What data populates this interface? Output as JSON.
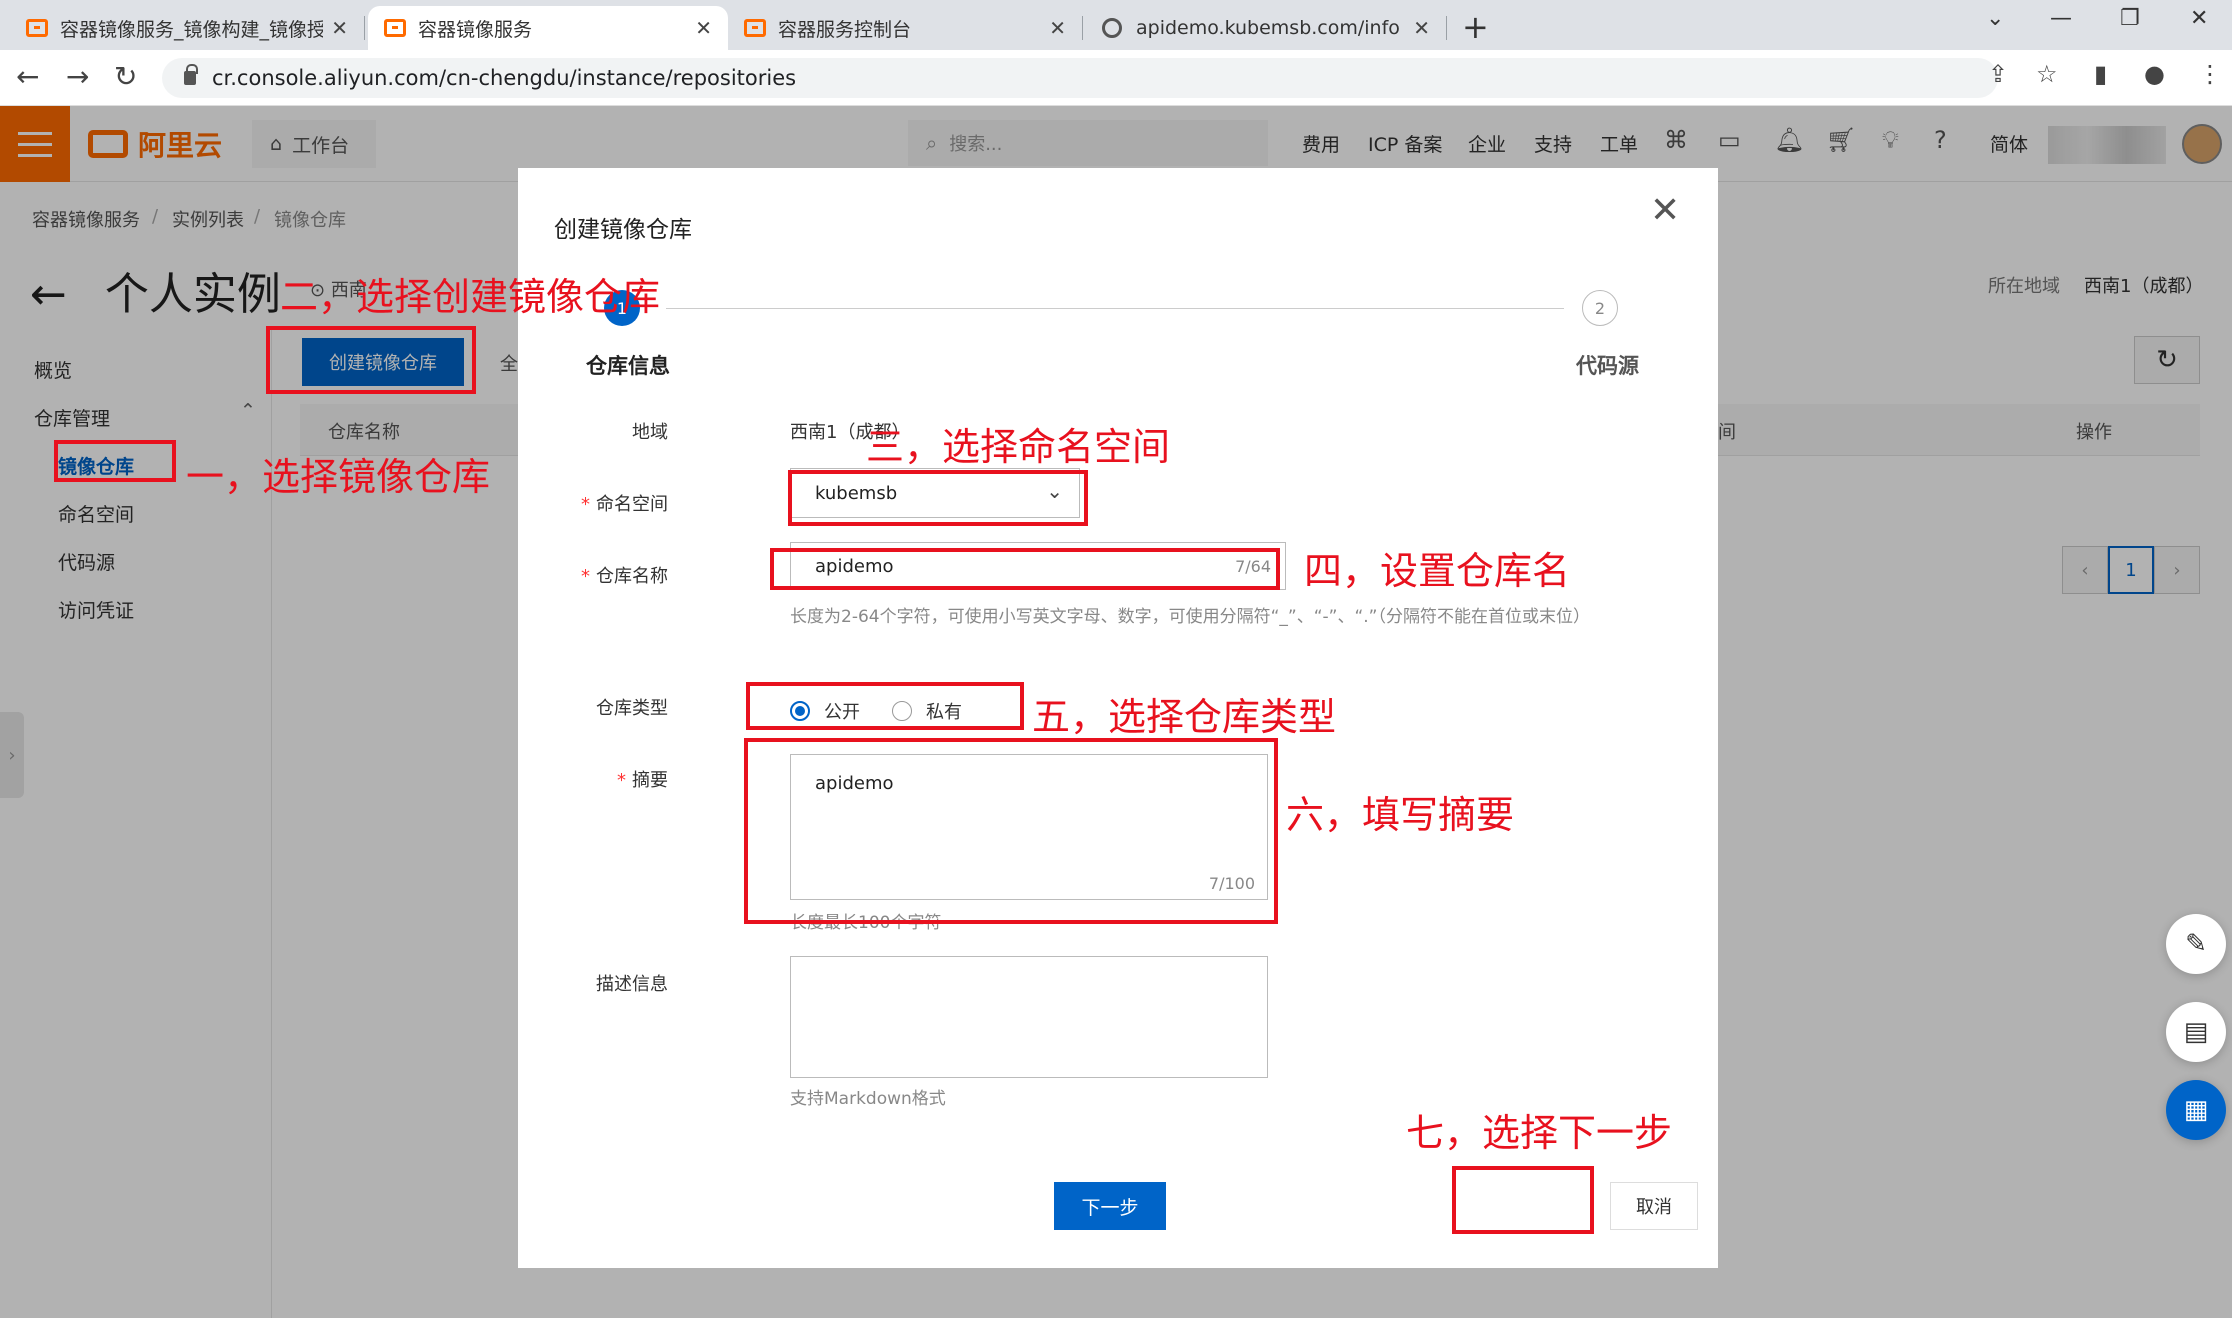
{
  "browser": {
    "tabs": [
      {
        "title": "容器镜像服务_镜像构建_镜像授权",
        "active": false
      },
      {
        "title": "容器镜像服务",
        "active": true
      },
      {
        "title": "容器服务控制台",
        "active": false
      },
      {
        "title": "apidemo.kubemsb.com/info",
        "active": false
      }
    ],
    "url": "cr.console.aliyun.com/cn-chengdu/instance/repositories"
  },
  "header": {
    "logo": "阿里云",
    "workbench": "工作台",
    "search_placeholder": "搜索...",
    "nav": [
      "费用",
      "ICP 备案",
      "企业",
      "支持",
      "工单"
    ],
    "lang": "简体"
  },
  "page": {
    "breadcrumb": [
      "容器镜像服务",
      "实例列表",
      "镜像仓库"
    ],
    "breadcrumb_sep": "/",
    "title": "个人实例",
    "region_label": "所在地域",
    "region_value": "西南1（成都）",
    "region_short": "西南",
    "all_tab": "全",
    "create_button": "创建镜像仓库",
    "table_headers": [
      "仓库名称",
      "间",
      "操作"
    ],
    "page_number": "1"
  },
  "sidebar": {
    "overview": "概览",
    "group": "仓库管理",
    "items": [
      "镜像仓库",
      "命名空间",
      "代码源",
      "访问凭证"
    ]
  },
  "modal": {
    "title": "创建镜像仓库",
    "steps": [
      {
        "num": "1",
        "label": "仓库信息"
      },
      {
        "num": "2",
        "label": "代码源"
      }
    ],
    "fields": {
      "region_label": "地域",
      "region_value": "西南1（成都）",
      "namespace_label": "命名空间",
      "namespace_value": "kubemsb",
      "repo_name_label": "仓库名称",
      "repo_name_value": "apidemo",
      "repo_name_counter": "7/64",
      "repo_name_hint": "长度为2-64个字符，可使用小写英文字母、数字，可使用分隔符“_”、“-”、“.”（分隔符不能在首位或末位）",
      "repo_type_label": "仓库类型",
      "repo_type_public": "公开",
      "repo_type_private": "私有",
      "summary_label": "摘要",
      "summary_value": "apidemo",
      "summary_counter": "7/100",
      "summary_hint": "长度最长100个字符",
      "description_label": "描述信息",
      "description_hint": "支持Markdown格式"
    },
    "next_button": "下一步",
    "cancel_button": "取消"
  },
  "annotations": {
    "step1": "一，选择镜像仓库",
    "step2": "二，选择创建镜像仓库",
    "step3": "三，选择命名空间",
    "step4": "四，设置仓库名",
    "step5": "五，选择仓库类型",
    "step6": "六，填写摘要",
    "step7": "七，选择下一步"
  },
  "colors": {
    "brand_orange": "#ff6a00",
    "primary_blue": "#0064c8",
    "annotation_red": "#e8111e"
  }
}
